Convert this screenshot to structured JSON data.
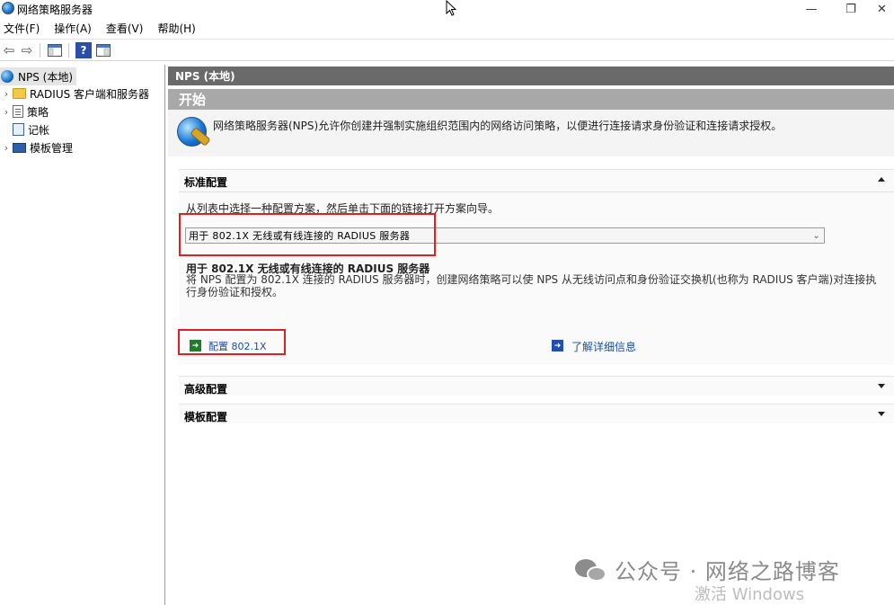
{
  "window": {
    "title": "网络策略服务器",
    "minimize_glyph": "—",
    "maximize_glyph": "❐",
    "close_glyph": "✕"
  },
  "menu": [
    "文件(F)",
    "操作(A)",
    "查看(V)",
    "帮助(H)"
  ],
  "toolbar": {
    "back_glyph": "⇦",
    "forward_glyph": "⇨",
    "help_glyph": "?"
  },
  "tree": {
    "root": "NPS (本地)",
    "items": [
      "RADIUS 客户端和服务器",
      "策略",
      "记帐",
      "模板管理"
    ]
  },
  "main": {
    "header": "NPS (本地)",
    "start_title": "开始",
    "intro": "网络策略服务器(NPS)允许你创建并强制实施组织范围内的网络访问策略，以便进行连接请求身份验证和连接请求授权。",
    "standard": {
      "title": "标准配置",
      "instruction": "从列表中选择一种配置方案，然后单击下面的链接打开方案向导。",
      "selected_option": "用于 802.1X 无线或有线连接的 RADIUS 服务器",
      "option_title": "用于 802.1X 无线或有线连接的 RADIUS 服务器",
      "option_desc": "将 NPS 配置为 802.1X 连接的 RADIUS 服务器时，创建网络策略可以使 NPS 从无线访问点和身份验证交换机(也称为 RADIUS 客户端)对连接执行身份验证和授权。",
      "configure_link": "配置 802.1X",
      "learn_more_link": "了解详细信息"
    },
    "advanced_title": "高级配置",
    "template_title": "模板配置"
  },
  "watermark": {
    "text": "公众号 · 网络之路博客",
    "activate": "激活 Windows"
  },
  "colors": {
    "nps_header_bg": "#6a6a6a",
    "start_header_bg": "#a8a8a8",
    "highlight_red": "#e02020",
    "link_blue": "#1a4fa8"
  }
}
